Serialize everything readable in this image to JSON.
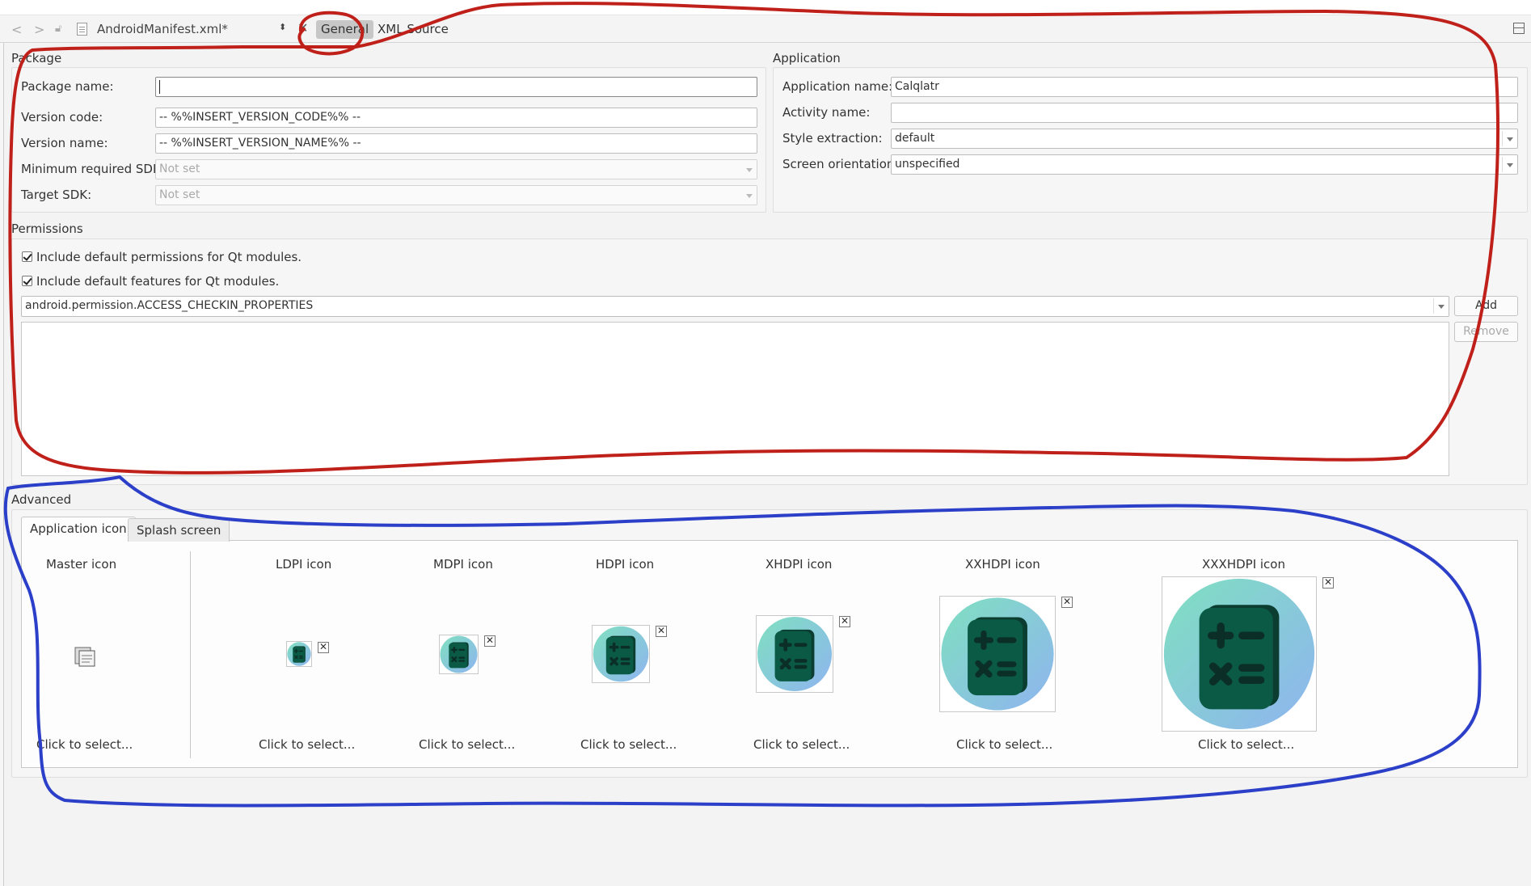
{
  "toolbar": {
    "back_glyph": "<",
    "forward_glyph": ">",
    "file_name": "AndroidManifest.xml*",
    "combo_arrows": "⬍",
    "close_glyph": "✕",
    "tabs": {
      "general": "General",
      "xml_source": "XML Source"
    }
  },
  "package": {
    "title": "Package",
    "labels": {
      "package_name": "Package name:",
      "version_code": "Version code:",
      "version_name": "Version name:",
      "min_sdk": "Minimum required SDK:",
      "target_sdk": "Target SDK:"
    },
    "values": {
      "package_name": "",
      "version_code": "-- %%INSERT_VERSION_CODE%% --",
      "version_name": "-- %%INSERT_VERSION_NAME%% --",
      "min_sdk": "Not set",
      "target_sdk": "Not set"
    }
  },
  "application": {
    "title": "Application",
    "labels": {
      "app_name": "Application name:",
      "activity_name": "Activity name:",
      "style_extraction": "Style extraction:",
      "screen_orientation": "Screen orientation:"
    },
    "values": {
      "app_name": "Calqlatr",
      "activity_name": "",
      "style_extraction": "default",
      "screen_orientation": "unspecified"
    }
  },
  "permissions": {
    "title": "Permissions",
    "include_default_permissions": "Include default permissions for Qt modules.",
    "include_default_features": "Include default features for Qt modules.",
    "permission_value": "android.permission.ACCESS_CHECKIN_PROPERTIES",
    "add_label": "Add",
    "remove_label": "Remove"
  },
  "advanced": {
    "title": "Advanced",
    "tabs": {
      "application_icon": "Application icon",
      "splash_screen": "Splash screen"
    },
    "master_icon_label": "Master icon",
    "click_label": "Click to select...",
    "icons": [
      "LDPI icon",
      "MDPI icon",
      "HDPI icon",
      "XHDPI icon",
      "XXHDPI icon",
      "XXXHDPI icon"
    ],
    "remove_glyph": "✕"
  },
  "colors": {
    "annotation_red": "#c0201a",
    "annotation_blue": "#2b3fc8",
    "icon_gradient_start": "#7fe0c0",
    "icon_gradient_end": "#8fb4f0",
    "icon_glyph": "#0a5a45"
  }
}
